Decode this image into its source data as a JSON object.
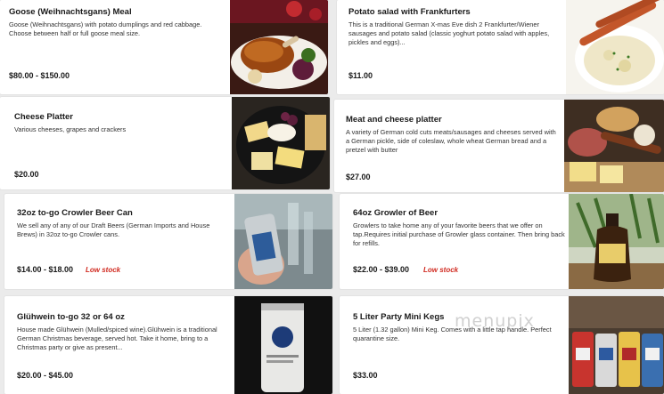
{
  "items": [
    {
      "title": "Goose (Weihnachtsgans) Meal",
      "description": "Goose (Weihnachtsgans) with potato dumplings and red cabbage. Choose between half or full goose meal size.",
      "price": "$80.00 - $150.00",
      "stock": "",
      "image": "roast-goose-photo"
    },
    {
      "title": "Potato salad with Frankfurters",
      "description": "This is a traditional German X-mas Eve dish 2 Frankfurter/Wiener sausages and potato salad (classic yoghurt potato salad with apples, pickles and eggs)...",
      "price": "$11.00",
      "stock": "",
      "image": "potato-salad-photo"
    },
    {
      "title": "Cheese Platter",
      "description": "Various cheeses, grapes and crackers",
      "price": "$20.00",
      "stock": "",
      "image": "cheese-platter-photo"
    },
    {
      "title": "Meat and cheese platter",
      "description": "A variety of German cold cuts meats/sausages and cheeses served with a German pickle, side of coleslaw, whole wheat German bread and a pretzel with butter",
      "price": "$27.00",
      "stock": "",
      "image": "meat-cheese-platter-photo"
    },
    {
      "title": "32oz to-go Crowler Beer Can",
      "description": "We sell any of any of our Draft Beers (German Imports and House Brews) in 32oz to-go Crowler cans.",
      "price": "$14.00 - $18.00",
      "stock": "Low stock",
      "image": "crowler-can-photo"
    },
    {
      "title": "64oz Growler of Beer",
      "description": "Growlers to take home any of your favorite beers that we offer on tap.Requires initial purchase of Growler glass container. Then bring back for refills.",
      "price": "$22.00 - $39.00",
      "stock": "Low stock",
      "image": "growler-photo"
    },
    {
      "title": "Glühwein to-go 32 or 64 oz",
      "description": "House made Glühwein (Mulled/spiced wine).Glühwein is a traditional German Christmas beverage, served hot. Take it home, bring to a Christmas party or give as present...",
      "price": "$20.00 - $45.00",
      "stock": "",
      "image": "gluehwein-can-photo"
    },
    {
      "title": "5 Liter Party Mini Kegs",
      "description": "5 Liter (1.32 gallon) Mini Keg. Comes with a little tap handle. Perfect quarantine size.",
      "price": "$33.00",
      "stock": "",
      "image": "mini-kegs-photo"
    }
  ],
  "watermark": "menupix"
}
